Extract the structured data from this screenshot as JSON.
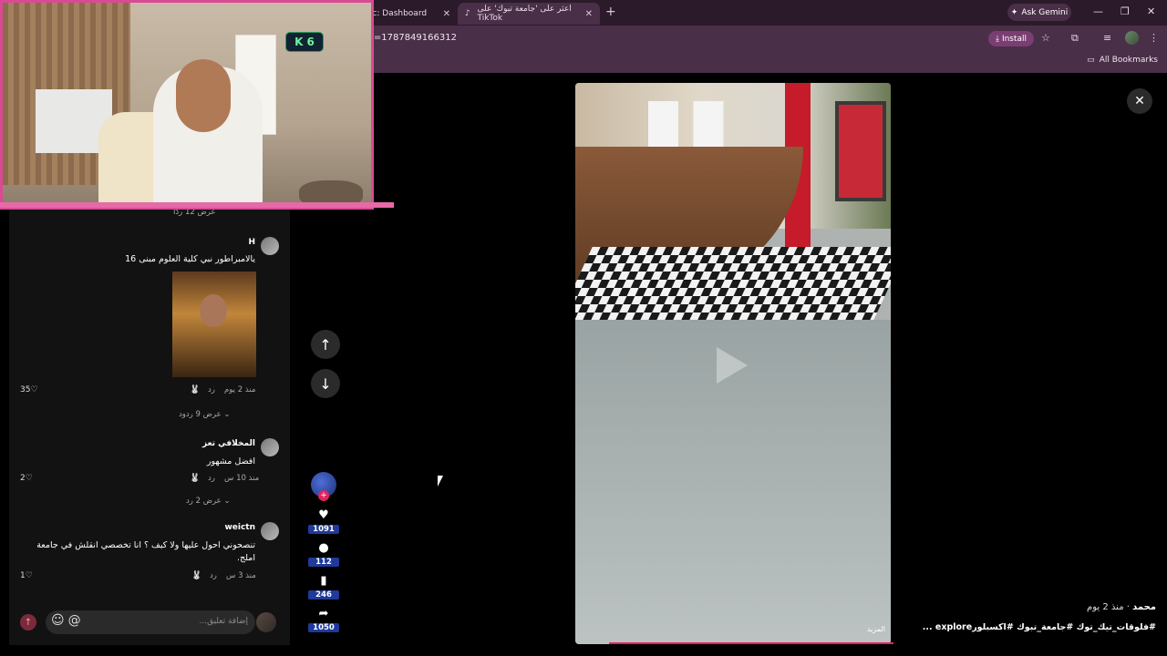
{
  "browser": {
    "tabs": [
      {
        "label": "Kic: Dashboard",
        "active": false
      },
      {
        "label": "اعثر على 'جامعة تبوك' على TikTok",
        "active": true
      }
    ],
    "new_tab_symbol": "+",
    "ask_gemini": "Ask Gemini",
    "url": "e&t=1787849166312",
    "install": "Install",
    "all_bookmarks": "All Bookmarks",
    "icons": {
      "minimize": "—",
      "restore": "❐",
      "close": "✕",
      "star": "☆",
      "extensions": "⧉",
      "menu": "⋮"
    }
  },
  "webcam": {
    "badge_value": "6",
    "badge_color": "#6ff29a",
    "border_color": "#d94a95"
  },
  "comments": {
    "top_view_replies": "عرض 12 ردًا",
    "items": [
      {
        "username": "H",
        "text": "يالامبراطور نبي كلية العلوم مبنى 16",
        "time": "منذ 2 يوم",
        "reply": "رد",
        "likes": "35",
        "view_replies": "عرض 9 ردود"
      },
      {
        "username": "المخلافي تعز",
        "text": "افضل مشهور",
        "time": "منذ 10 س",
        "reply": "رد",
        "likes": "2",
        "view_replies": "عرض 2 رد"
      },
      {
        "username": "weictn",
        "text": "تنصحوني احول عليها ولا كيف ؟ انا تخصصي انقلش في جامعة املج.",
        "time": "منذ 3 س",
        "reply": "رد",
        "likes": "1"
      }
    ],
    "input_placeholder": "إضافة تعليق...",
    "input_icons": {
      "emoji": "☺",
      "mention": "@"
    },
    "send_icon": "↑"
  },
  "actions": {
    "likes": "1091",
    "comments": "112",
    "saves": "246",
    "shares": "1050"
  },
  "nav": {
    "up": "↑",
    "down": "↓",
    "close": "✕"
  },
  "video": {
    "more": "المزيد",
    "author": "محمد",
    "posted": "· منذ 2 يوم",
    "tags": "#فلوقات_تيك_توك #جامعة_تبوك #اكسبلورexplore ..."
  }
}
